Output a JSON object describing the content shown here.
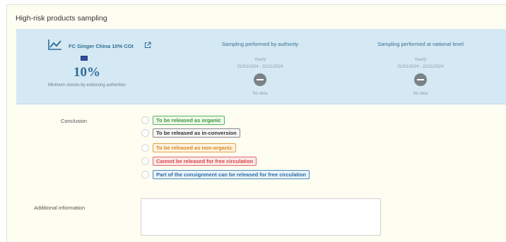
{
  "panel": {
    "title": "High-risk products sampling"
  },
  "product": {
    "name": "FC Ginger China 10% COI",
    "icon": "line-chart-icon",
    "link_icon": "external-link-icon",
    "flag": "eu-flag-icon",
    "percentage": "10%",
    "percentage_label": "Minimum checks by endorsing authorities"
  },
  "authority": {
    "heading": "Sampling performed by authority",
    "frequency": "Yearly",
    "range": "01/01/2024 - 22/11/2024",
    "status_icon": "minus-circle-icon",
    "status": "No data"
  },
  "national": {
    "heading": "Sampling performed at national level",
    "frequency": "Yearly",
    "range": "01/01/2024 - 22/11/2024",
    "status_icon": "minus-circle-icon",
    "status": "No data"
  },
  "conclusion": {
    "label": "Conclusion",
    "options": [
      {
        "label": "To be released as organic",
        "color": "#3f9a3f"
      },
      {
        "label": "To be released as in-conversion",
        "color": "#333333"
      },
      {
        "label": "To be released as non-organic",
        "color": "#d98a1e"
      },
      {
        "label": "Cannot be released for free circulation",
        "color": "#d94848"
      },
      {
        "label": "Part of the consignment can be released for free circulation",
        "color": "#2b6fa5"
      }
    ]
  },
  "additional": {
    "label": "Additional information",
    "value": ""
  }
}
